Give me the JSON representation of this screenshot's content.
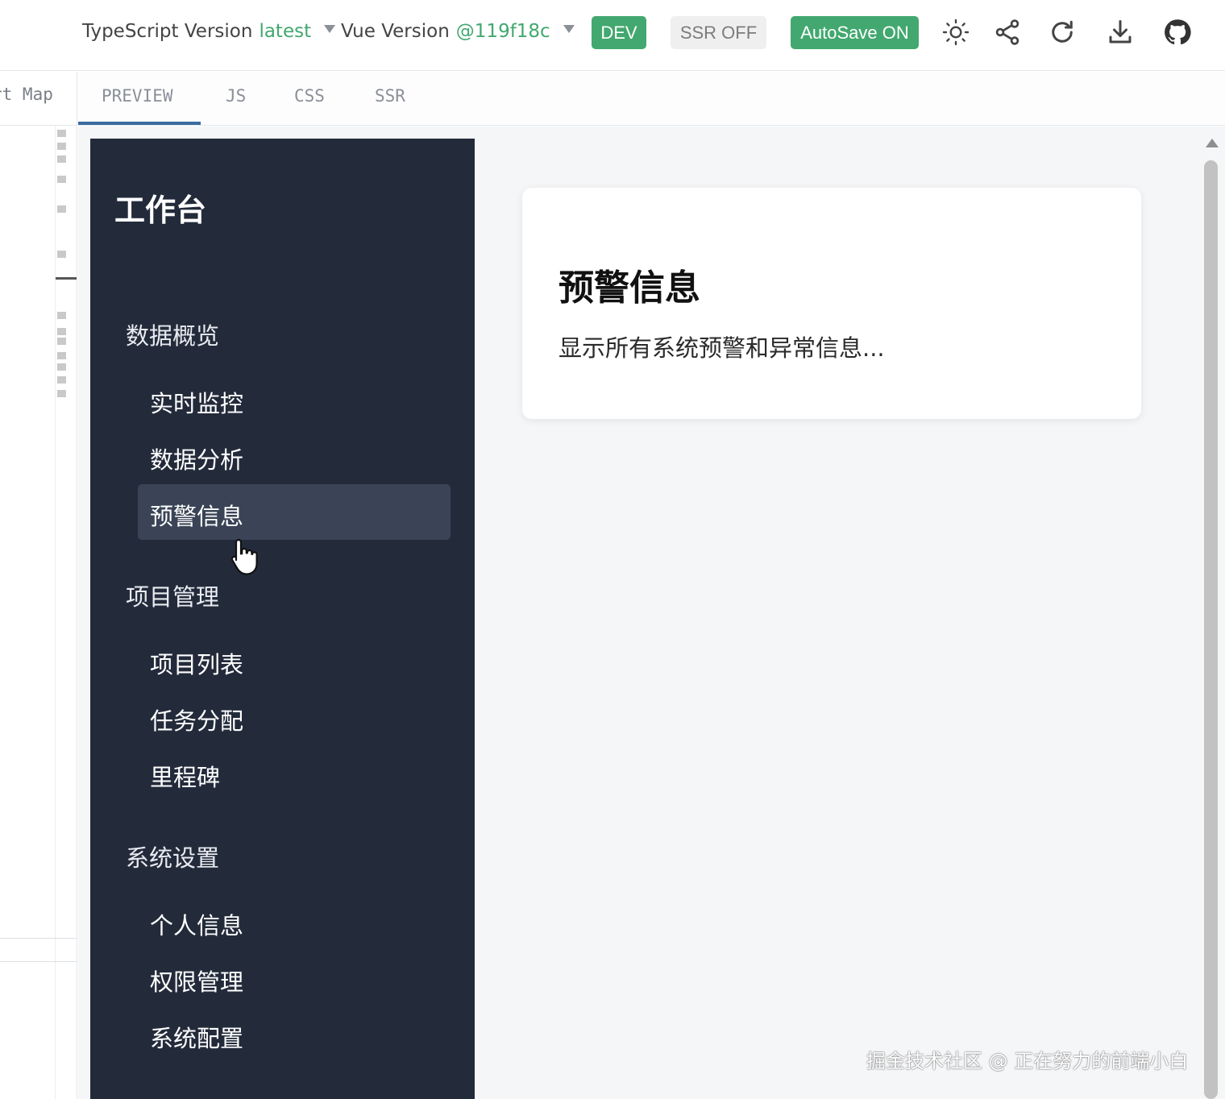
{
  "header": {
    "typescript": {
      "label": "TypeScript Version",
      "value": "latest"
    },
    "vue": {
      "label": "Vue Version",
      "value": "@119f18c"
    },
    "dev_label": "DEV",
    "ssr_label": "SSR OFF",
    "autosave_label": "AutoSave ON",
    "icons": [
      "sun-icon",
      "share-icon",
      "reload-icon",
      "download-icon",
      "github-icon"
    ],
    "accent_color": "#42a86f"
  },
  "editor": {
    "tab_label": "rt Map"
  },
  "output_tabs": [
    "PREVIEW",
    "JS",
    "CSS",
    "SSR"
  ],
  "active_output_tab": "PREVIEW",
  "app": {
    "title": "工作台",
    "groups": [
      {
        "label": "数据概览",
        "items": [
          "实时监控",
          "数据分析",
          "预警信息"
        ]
      },
      {
        "label": "项目管理",
        "items": [
          "项目列表",
          "任务分配",
          "里程碑"
        ]
      },
      {
        "label": "系统设置",
        "items": [
          "个人信息",
          "权限管理",
          "系统配置"
        ]
      }
    ],
    "active_item": "预警信息",
    "sidebar_color": "#232b3b",
    "card": {
      "title": "预警信息",
      "text": "显示所有系统预警和异常信息..."
    }
  },
  "watermark": "掘金技术社区 @ 正在努力的前端小白"
}
